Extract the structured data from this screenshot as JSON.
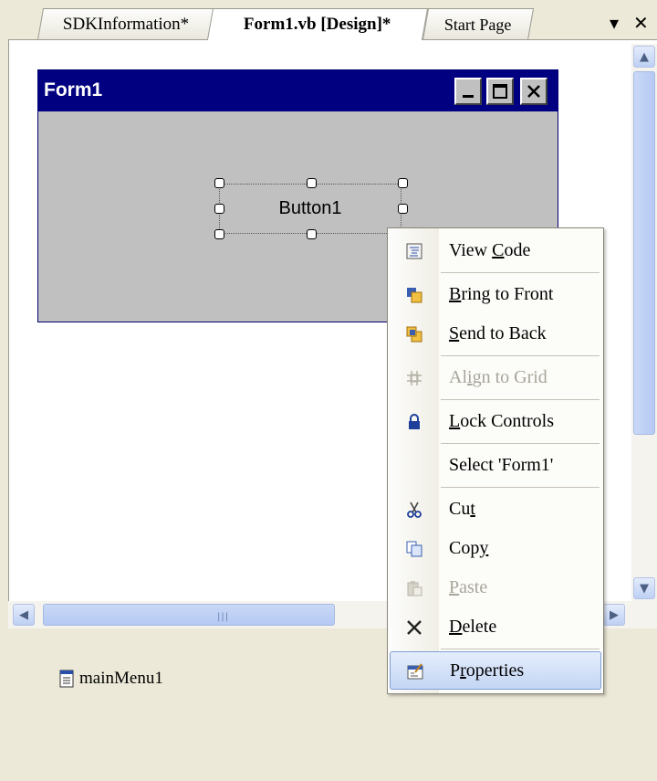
{
  "tabs": [
    {
      "label": "SDKInformation*",
      "active": false
    },
    {
      "label": "Form1.vb [Design]*",
      "active": true
    },
    {
      "label": "Start Page",
      "active": false
    }
  ],
  "tab_controls": {
    "dropdown_icon": "dropdown-icon",
    "close_icon": "close-icon"
  },
  "form": {
    "title": "Form1",
    "caption_buttons": [
      "minimize",
      "maximize",
      "close"
    ],
    "button": {
      "label": "Button1"
    }
  },
  "context_menu": {
    "items": [
      {
        "label": "View Code",
        "mnemonic": "C",
        "icon": "code-view-icon",
        "enabled": true
      },
      {
        "label": "Bring to Front",
        "mnemonic": "B",
        "icon": "bring-to-front-icon",
        "enabled": true
      },
      {
        "label": "Send to Back",
        "mnemonic": "S",
        "icon": "send-to-back-icon",
        "enabled": true
      },
      {
        "label": "Align to Grid",
        "mnemonic": "i",
        "icon": "align-grid-icon",
        "enabled": false
      },
      {
        "label": "Lock Controls",
        "mnemonic": "L",
        "icon": "lock-icon",
        "enabled": true
      },
      {
        "label": "Select 'Form1'",
        "mnemonic": "",
        "icon": "",
        "enabled": true
      },
      {
        "label": "Cut",
        "mnemonic": "t",
        "icon": "cut-icon",
        "enabled": true
      },
      {
        "label": "Copy",
        "mnemonic": "y",
        "icon": "copy-icon",
        "enabled": true
      },
      {
        "label": "Paste",
        "mnemonic": "P",
        "icon": "paste-icon",
        "enabled": false
      },
      {
        "label": "Delete",
        "mnemonic": "D",
        "icon": "delete-icon",
        "enabled": true
      },
      {
        "label": "Properties",
        "mnemonic": "r",
        "icon": "properties-icon",
        "enabled": true,
        "highlighted": true
      }
    ]
  },
  "tray": {
    "items": [
      {
        "label": "mainMenu1",
        "icon": "main-menu-icon"
      }
    ]
  },
  "colors": {
    "form_titlebar": "#000080",
    "form_body": "#c0c0c0",
    "menu_highlight": "#c4d6f5"
  }
}
